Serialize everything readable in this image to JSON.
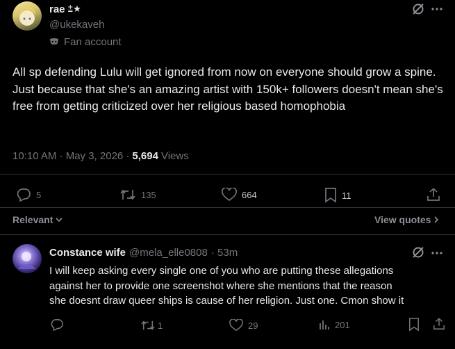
{
  "main_post": {
    "display_name": "rae",
    "name_emoji": "⩲★",
    "handle": "@ukekaveh",
    "badge_label": "Fan account",
    "text": "All sp defending Lulu will get ignored from now on everyone should grow a spine. Just because that she's an amazing artist with 150k+ followers doesn't mean she's free from getting criticized over her religious based homophobia",
    "timestamp": "10:10 AM · May 3, 2026 ·",
    "views_count": "5,694",
    "views_label": "Views",
    "actions": {
      "replies": "5",
      "reposts": "135",
      "likes": "664",
      "bookmarks": "11"
    }
  },
  "sort": {
    "relevant_label": "Relevant",
    "view_quotes_label": "View quotes"
  },
  "reply": {
    "display_name": "Constance wife",
    "handle": "@mela_elle0808",
    "time": "· 53m",
    "lines": [
      "I will keep asking every single one of you who are putting these allegations",
      "against her to provide one screenshot where she mentions that the reason",
      "she doesnt draw queer ships is cause of her religion. Just one. Cmon show it"
    ],
    "actions": {
      "reposts": "1",
      "likes": "29",
      "views": "201"
    }
  },
  "colors": {
    "background": "#000000",
    "text": "#e7e9ea",
    "muted": "#71767b",
    "divider": "#2f3336"
  },
  "icons": [
    "grok-icon",
    "more-icon",
    "mask-icon",
    "reply-icon",
    "repost-icon",
    "like-icon",
    "bookmark-icon",
    "share-icon",
    "views-icon",
    "chevron-down-icon",
    "chevron-right-icon"
  ]
}
